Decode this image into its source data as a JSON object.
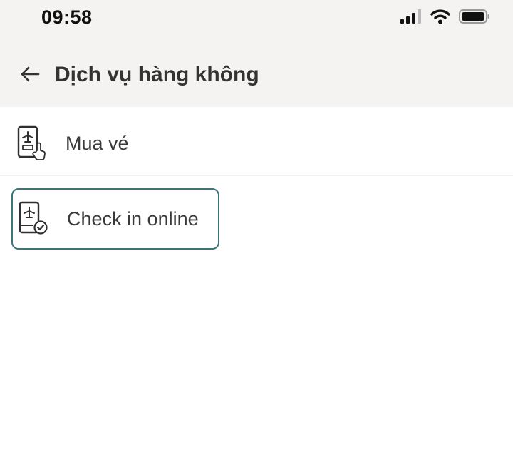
{
  "status_bar": {
    "time": "09:58",
    "icons": [
      "signal-icon",
      "wifi-icon",
      "battery-icon"
    ]
  },
  "header": {
    "back_icon": "arrow-left-icon",
    "title": "Dịch vụ hàng không"
  },
  "menu": {
    "items": [
      {
        "label": "Mua vé",
        "icon": "mobile-flight-ticket-tap-icon",
        "selected": false
      },
      {
        "label": "Check in online",
        "icon": "mobile-flight-checkin-icon",
        "selected": true
      }
    ]
  },
  "colors": {
    "header_background": "#f5f3f1",
    "selected_border": "#3d7478",
    "text": "#333333",
    "icon_stroke": "#2f2f2f"
  }
}
